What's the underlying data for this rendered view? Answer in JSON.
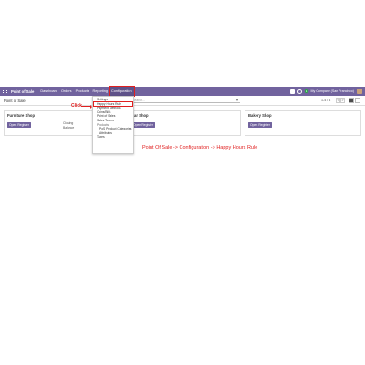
{
  "navbar": {
    "brand": "Point of Sale",
    "menu": [
      "Dashboard",
      "Orders",
      "Products",
      "Reporting",
      "Configuration"
    ],
    "badge_count": "1",
    "company": "My Company (San Francisco)"
  },
  "control_panel": {
    "breadcrumb": "Point of Sale",
    "search_placeholder": "Search...",
    "pager": "1-4 / 4",
    "prev": "<",
    "next": ">"
  },
  "cards": [
    {
      "title": "Furniture Shop",
      "button": "Open Register",
      "closing_label": "Closing",
      "balance_label": "Balance"
    },
    {
      "title": "Bar Shop",
      "button": "Open Register"
    },
    {
      "title": "Bakery Shop",
      "button": "Open Register"
    }
  ],
  "dropdown": {
    "items_top": [
      "Settings",
      "Happy Hours Rule",
      "Payment Methods",
      "Coins/Bills",
      "Point of Sales",
      "Sales Teams"
    ],
    "header": "Products",
    "items_sub": [
      "PoS Product Categories",
      "Attributes"
    ],
    "items_bottom": [
      "Taxes"
    ]
  },
  "annotation": {
    "click_label": "Click",
    "path_note": "Point Of Sale -> Configuration -> Happy Hours Rule",
    "color": "#e02020"
  },
  "colors": {
    "brand": "#71639e"
  }
}
